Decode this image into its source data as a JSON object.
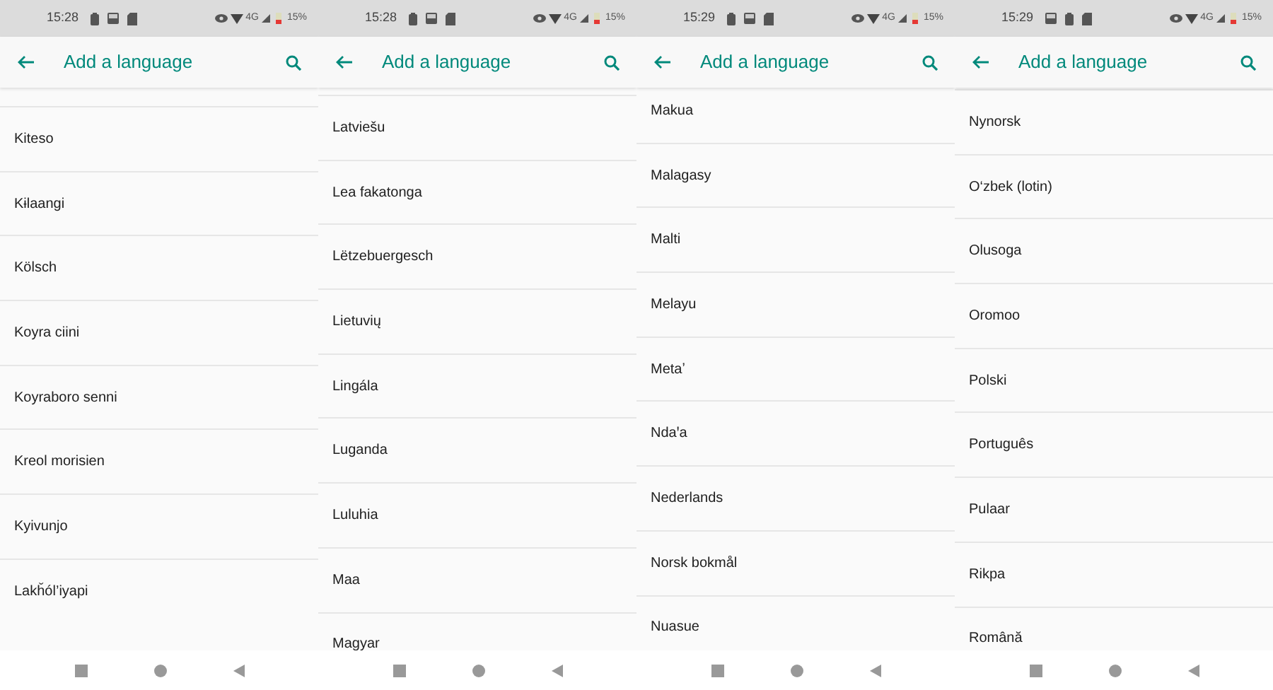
{
  "panels": [
    {
      "status_bar": {
        "time": "15:28",
        "notification_icons": [
          {
            "kind": "battery"
          },
          {
            "kind": "image"
          },
          {
            "kind": "sd-card"
          }
        ],
        "network": "4G",
        "battery": "15%"
      },
      "toolbar": {
        "title": "Add a language"
      },
      "languages": [
        "Kiteso",
        "Kɨlaangi",
        "Kölsch",
        "Koyra ciini",
        "Koyraboro senni",
        "Kreol morisien",
        "Kyivunjo",
        "Lakȟól’iyapi"
      ]
    },
    {
      "status_bar": {
        "time": "15:28",
        "notification_icons": [
          {
            "kind": "battery"
          },
          {
            "kind": "image"
          },
          {
            "kind": "sd-card"
          }
        ],
        "network": "4G",
        "battery": "15%"
      },
      "toolbar": {
        "title": "Add a language"
      },
      "languages": [
        "Latviešu",
        "Lea fakatonga",
        "Lëtzebuergesch",
        "Lietuvių",
        "Lingála",
        "Luganda",
        "Luluhia",
        "Maa",
        "Magyar"
      ]
    },
    {
      "status_bar": {
        "time": "15:29",
        "notification_icons": [
          {
            "kind": "battery"
          },
          {
            "kind": "image"
          },
          {
            "kind": "sd-card"
          }
        ],
        "network": "4G",
        "battery": "15%"
      },
      "toolbar": {
        "title": "Add a language"
      },
      "languages": [
        "Makua",
        "Malagasy",
        "Malti",
        "Melayu",
        "Metaʼ",
        "Ndaꞌa",
        "Nederlands",
        "Norsk bokmål",
        "Nuasue"
      ]
    },
    {
      "status_bar": {
        "time": "15:29",
        "notification_icons": [
          {
            "kind": "image"
          },
          {
            "kind": "battery"
          },
          {
            "kind": "sd-card"
          }
        ],
        "network": "4G",
        "battery": "15%"
      },
      "toolbar": {
        "title": "Add a language"
      },
      "languages": [
        "Nynorsk",
        "O‘zbek (lotin)",
        "Olusoga",
        "Oromoo",
        "Polski",
        "Português",
        "Pulaar",
        "Rikpa",
        "Română"
      ]
    }
  ]
}
